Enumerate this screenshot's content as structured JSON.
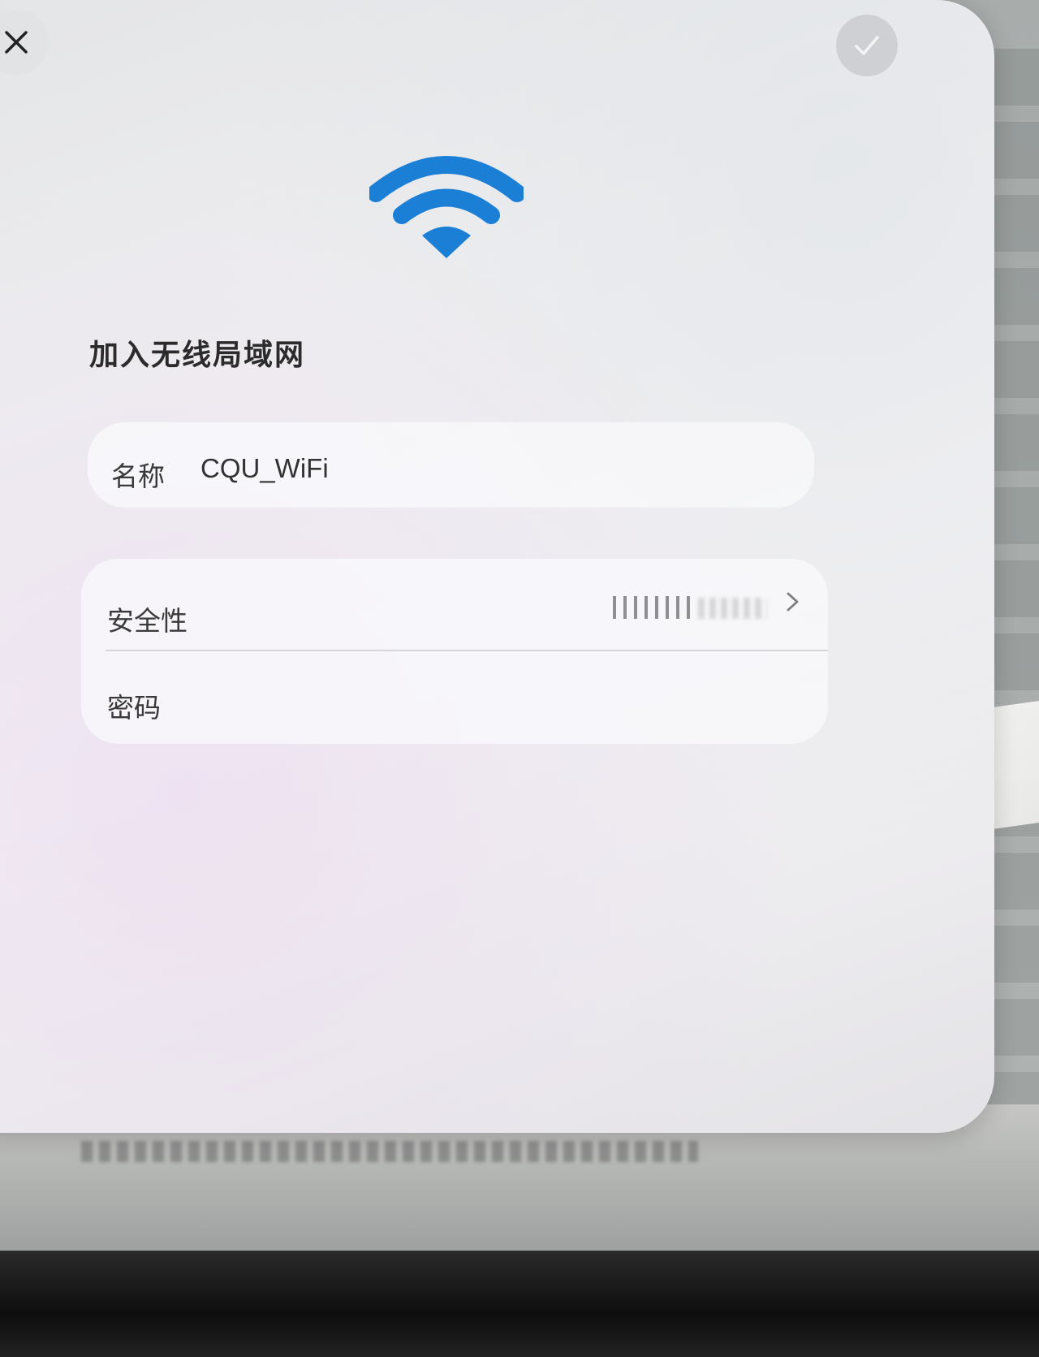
{
  "dialog": {
    "title": "加入无线局域网",
    "close_icon": "close-icon",
    "confirm_icon": "checkmark-icon",
    "header_icon": "wifi-icon",
    "accent_color": "#1b7fd6"
  },
  "network": {
    "name_label": "名称",
    "name_value": "CQU_WiFi"
  },
  "security": {
    "security_label": "安全性",
    "security_value_icon": "obscured-text",
    "chevron_icon": "chevron-right-icon",
    "password_label": "密码",
    "password_value": ""
  }
}
